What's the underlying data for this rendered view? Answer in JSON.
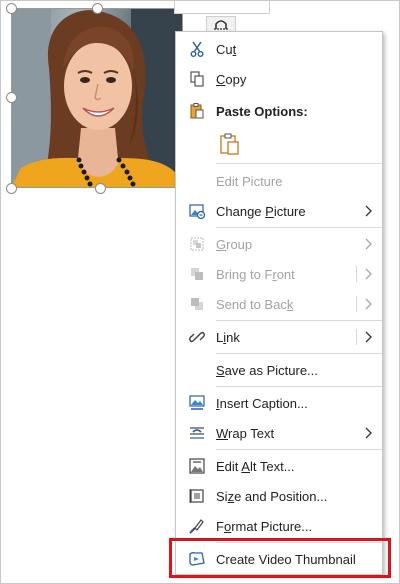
{
  "menu": {
    "cut": {
      "pre": "Cu",
      "key": "t",
      "post": "",
      "icon": "scissors-icon"
    },
    "copy": {
      "pre": "",
      "key": "C",
      "post": "opy",
      "icon": "copy-icon"
    },
    "paste_options": {
      "label": "Paste Options:",
      "icon": "paste-icon"
    },
    "paste_keep": {
      "icon": "paste-keep-format-icon"
    },
    "edit_picture": {
      "label": "Edit Picture",
      "disabled": true
    },
    "change_picture": {
      "pre": "Change ",
      "key": "P",
      "post": "icture",
      "icon": "change-picture-icon"
    },
    "group": {
      "pre": "",
      "key": "G",
      "post": "roup",
      "icon": "group-icon",
      "disabled": true
    },
    "bring_to_front": {
      "pre": "Bring to F",
      "key": "r",
      "post": "ont",
      "icon": "bring-front-icon",
      "disabled": true
    },
    "send_to_back": {
      "pre": "Send to Bac",
      "key": "k",
      "post": "",
      "icon": "send-back-icon",
      "disabled": true
    },
    "link": {
      "pre": "L",
      "key": "i",
      "post": "nk",
      "icon": "link-icon"
    },
    "save_as_picture": {
      "pre": "",
      "key": "S",
      "post": "ave as Picture...",
      "icon": ""
    },
    "insert_caption": {
      "pre": "",
      "key": "I",
      "post": "nsert Caption...",
      "icon": "insert-caption-icon"
    },
    "wrap_text": {
      "pre": "",
      "key": "W",
      "post": "rap Text",
      "icon": "wrap-text-icon"
    },
    "edit_alt_text": {
      "pre": "Edit ",
      "key": "A",
      "post": "lt Text...",
      "icon": "alt-text-icon"
    },
    "size_position": {
      "pre": "Si",
      "key": "z",
      "post": "e and Position...",
      "icon": "size-position-icon"
    },
    "format_picture": {
      "pre": "F",
      "key": "o",
      "post": "rmat Picture...",
      "icon": "format-picture-icon"
    },
    "create_video_thumbnail": {
      "label": "Create Video Thumbnail",
      "icon": "video-thumbnail-icon"
    }
  },
  "colors": {
    "highlight": "#d8141f",
    "accent_blue": "#1e6fbf",
    "disabled_text": "#a3a3a3"
  }
}
